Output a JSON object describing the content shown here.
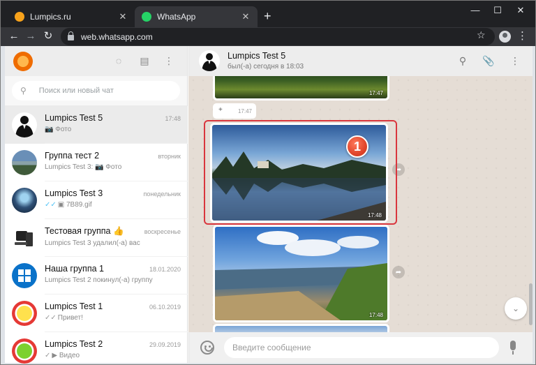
{
  "browser": {
    "tabs": [
      {
        "title": "Lumpics.ru",
        "favicon_color": "#f7a21b"
      },
      {
        "title": "WhatsApp",
        "favicon_color": "#25d366"
      }
    ],
    "address": "web.whatsapp.com"
  },
  "sidebar": {
    "search_placeholder": "Поиск или новый чат",
    "chats": [
      {
        "name": "Lumpics Test 5",
        "time": "17:48",
        "preview": "Фото",
        "preview_icon": "camera-icon",
        "selected": true
      },
      {
        "name": "Группа тест 2",
        "time": "вторник",
        "preview": "Lumpics Test 3: 📷 Фото"
      },
      {
        "name": "Lumpics Test 3",
        "time": "понедельник",
        "preview": "7B89.gif",
        "preview_icon": "double-check-gif-icon"
      },
      {
        "name": "Тестовая группа 👍",
        "time": "воскресенье",
        "preview": "Lumpics Test 3 удалил(-а) вас"
      },
      {
        "name": "Наша группа 1",
        "time": "18.01.2020",
        "preview": "Lumpics Test 2 покинул(-а) группу"
      },
      {
        "name": "Lumpics Test 1",
        "time": "06.10.2019",
        "preview": "Привет!",
        "preview_icon": "double-check-icon"
      },
      {
        "name": "Lumpics Test 2",
        "time": "29.09.2019",
        "preview": "Видео",
        "preview_icon": "video-icon"
      }
    ]
  },
  "conversation": {
    "name": "Lumpics Test 5",
    "status": "был(-а) сегодня в 18:03",
    "messages": [
      {
        "type": "image",
        "time": "17:47"
      },
      {
        "type": "text",
        "text": "+",
        "time": "17:47"
      },
      {
        "type": "image",
        "time": "17:48",
        "highlighted": true,
        "badge": "1"
      },
      {
        "type": "image",
        "time": "17:48"
      }
    ],
    "composer_placeholder": "Введите сообщение"
  }
}
